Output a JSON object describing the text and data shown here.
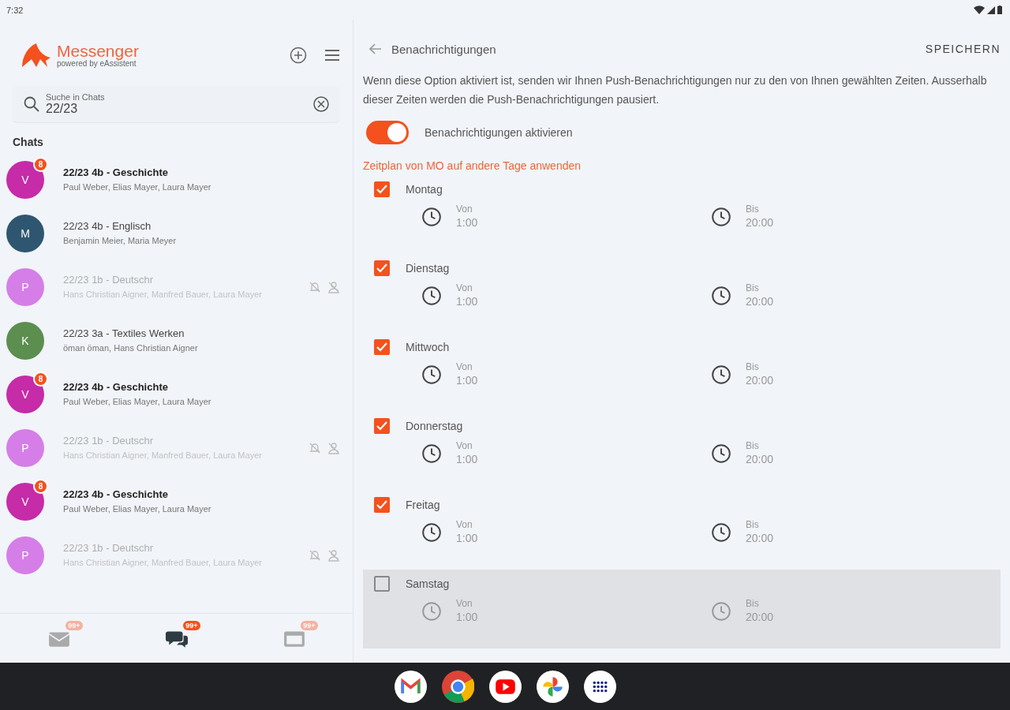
{
  "status_bar": {
    "time": "7:32"
  },
  "sidebar": {
    "app_title": "Messenger",
    "app_subtitle": "powered by eAssistent",
    "search": {
      "label": "Suche in Chats",
      "value": "22/23"
    },
    "section_title": "Chats",
    "chats": [
      {
        "avatar": "V",
        "color": "#c62ba8",
        "badge": "8",
        "title": "22/23  4b - Geschichte",
        "members": "Paul Weber, Elias Mayer, Laura Mayer",
        "unread": true,
        "muted": false
      },
      {
        "avatar": "M",
        "color": "#2f5670",
        "title": "22/23  4b - Englisch",
        "members": "Benjamin Meier, Maria Meyer",
        "unread": false,
        "muted": false
      },
      {
        "avatar": "P",
        "color": "#d57ee8",
        "title": "22/23  1b - Deutschr",
        "members": "Hans Christian Aigner, Manfred Bauer, Laura Mayer",
        "unread": false,
        "muted": true
      },
      {
        "avatar": "K",
        "color": "#5b8e4f",
        "title": "22/23 3a - Textiles Werken",
        "members": "öman öman, Hans Christian Aigner",
        "unread": false,
        "muted": false
      },
      {
        "avatar": "V",
        "color": "#c62ba8",
        "badge": "8",
        "title": "22/23  4b - Geschichte",
        "members": "Paul Weber, Elias Mayer, Laura Mayer",
        "unread": true,
        "muted": false
      },
      {
        "avatar": "P",
        "color": "#d57ee8",
        "title": "22/23  1b - Deutschr",
        "members": "Hans Christian Aigner, Manfred Bauer, Laura Mayer",
        "unread": false,
        "muted": true
      },
      {
        "avatar": "V",
        "color": "#c62ba8",
        "badge": "8",
        "title": "22/23  4b - Geschichte",
        "members": "Paul Weber, Elias Mayer, Laura Mayer",
        "unread": true,
        "muted": false
      },
      {
        "avatar": "P",
        "color": "#d57ee8",
        "title": "22/23  1b - Deutschr",
        "members": "Hans Christian Aigner, Manfred Bauer, Laura Mayer",
        "unread": false,
        "muted": true
      }
    ],
    "bottom_nav": [
      {
        "kind": "mail",
        "badge": "99+",
        "selected": false
      },
      {
        "kind": "chat",
        "badge": "99+",
        "selected": true
      },
      {
        "kind": "calendar",
        "badge": "99+",
        "selected": false
      }
    ]
  },
  "detail": {
    "title": "Benachrichtigungen",
    "save_label": "SPEICHERN",
    "description": "Wenn diese Option aktiviert ist, senden wir Ihnen Push-Benachrichtigungen nur zu den von Ihnen gewählten Zeiten. Ausserhalb dieser Zeiten werden die Push-Benachrichtigungen pausiert.",
    "toggle": {
      "label": "Benachrichtigungen aktivieren",
      "on": true
    },
    "apply_link": "Zeitplan von MO auf andere Tage anwenden",
    "days": [
      {
        "name": "Montag",
        "checked": true,
        "from_label": "Von",
        "from": "1:00",
        "to_label": "Bis",
        "to": "20:00"
      },
      {
        "name": "Dienstag",
        "checked": true,
        "from_label": "Von",
        "from": "1:00",
        "to_label": "Bis",
        "to": "20:00"
      },
      {
        "name": "Mittwoch",
        "checked": true,
        "from_label": "Von",
        "from": "1:00",
        "to_label": "Bis",
        "to": "20:00"
      },
      {
        "name": "Donnerstag",
        "checked": true,
        "from_label": "Von",
        "from": "1:00",
        "to_label": "Bis",
        "to": "20:00"
      },
      {
        "name": "Freitag",
        "checked": true,
        "from_label": "Von",
        "from": "1:00",
        "to_label": "Bis",
        "to": "20:00"
      },
      {
        "name": "Samstag",
        "checked": false,
        "from_label": "Von",
        "from": "1:00",
        "to_label": "Bis",
        "to": "20:00"
      }
    ]
  },
  "taskbar": [
    {
      "kind": "mail"
    },
    {
      "kind": "browser"
    },
    {
      "kind": "video"
    },
    {
      "kind": "photos"
    },
    {
      "kind": "apps"
    }
  ]
}
